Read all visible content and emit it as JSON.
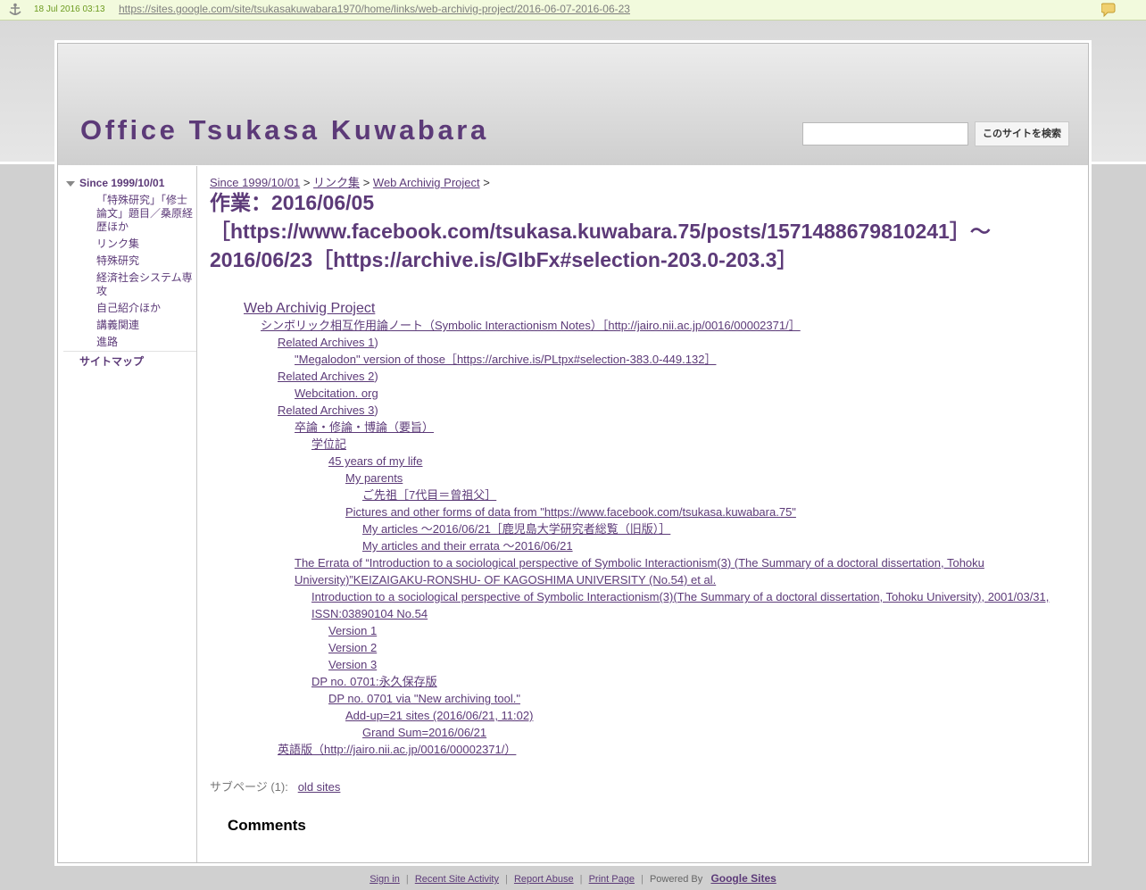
{
  "archive_bar": {
    "date": "18 Jul 2016 03:13",
    "url": "https://sites.google.com/site/tsukasakuwabara1970/home/links/web-archivig-project/2016-06-07-2016-06-23"
  },
  "header": {
    "site_title": "Office Tsukasa Kuwabara",
    "search_button": "このサイトを検索",
    "search_value": ""
  },
  "sidebar": {
    "root": "Since 1999/10/01",
    "items": [
      "「特殊研究」「修士論文」題目／桑原経歴ほか",
      "リンク集",
      "特殊研究",
      "経済社会システム専攻",
      "自己紹介ほか",
      "講義関連",
      "進路"
    ],
    "sitemap": "サイトマップ"
  },
  "breadcrumb": {
    "items": [
      "Since 1999/10/01",
      "リンク集",
      "Web Archivig Project"
    ],
    "separator": ">"
  },
  "page_title": "作業：2016/06/05［https://www.facebook.com/tsukasa.kuwabara.75/posts/1571488679810241］～2016/06/23［https://archive.is/GIbFx#selection-203.0-203.3］",
  "tree": {
    "root": "Web Archivig Project",
    "items": [
      "シンボリック相互作用論ノート（Symbolic Interactionism Notes）［http://jairo.nii.ac.jp/0016/00002371/］",
      "Related Archives 1",
      ")",
      "\"Megalodon\" version of those［https://archive.is/PLtpx#selection-383.0-449.132］",
      "Related Archives 2",
      ")",
      "Webcitation. org",
      "Related Archives 3",
      ")",
      "卒論・修論・博論（要旨）",
      "学位記",
      "45 years of my life",
      "My parents",
      "ご先祖［7代目＝曾祖父］",
      "Pictures and other forms of data from \"https://www.facebook.com/tsukasa.kuwabara.75\"",
      "My articles ～2016/06/21［鹿児島大学研究者総覧（旧版）］",
      "My articles and their errata ～2016/06/21",
      "The Errata of “Introduction to a sociological perspective of Symbolic Interactionism(3) (The Summary of a doctoral dissertation, Tohoku University)”KEIZAIGAKU-RONSHU- OF KAGOSHIMA UNIVERSITY (No.54) et al.",
      "Introduction to a sociological perspective of Symbolic Interactionism(3)(The Summary of a doctoral dissertation, Tohoku University), 2001/03/31, ISSN:03890104 No.54",
      "Version 1",
      "Version 2",
      "Version 3",
      "DP no. 0701:永久保存版",
      "DP no. 0701 via \"New archiving tool.\"",
      "Add-up=21 sites (2016/06/21, 11:02)",
      "Grand Sum=2016/06/21",
      "英語版（http://jairo.nii.ac.jp/0016/00002371/）"
    ]
  },
  "subpages": {
    "label": "サブページ (1):",
    "link": "old sites"
  },
  "comments_heading": "Comments",
  "footer": {
    "links": [
      "Sign in",
      "Recent Site Activity",
      "Report Abuse",
      "Print Page"
    ],
    "separator": "|",
    "powered": "Powered By",
    "brand": "Google Sites"
  }
}
